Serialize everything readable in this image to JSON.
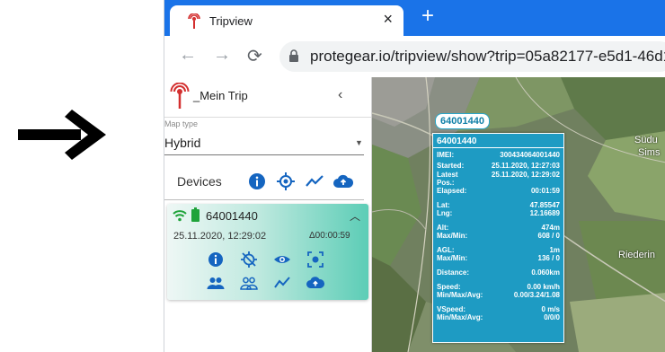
{
  "browser": {
    "tab_title": "Tripview",
    "url": "protegear.io/tripview/show?trip=05a82177-e5d1-46d1",
    "accent": "#1a73e8"
  },
  "sidebar": {
    "trip_title": "_Mein Trip",
    "map_type_label": "Map type",
    "map_type_value": "Hybrid",
    "devices_label": "Devices"
  },
  "device": {
    "name": "64001440",
    "timestamp": "25.11.2020, 12:29:02",
    "elapsed": "Δ00:00:59"
  },
  "map": {
    "marker_label": "64001440",
    "place_1": "Südu",
    "place_2": "Sims",
    "place_3": "Riederin"
  },
  "popup": {
    "title": "64001440",
    "rows": [
      {
        "k": "IMEI:",
        "v": "300434064001440"
      },
      {
        "k": "Started:",
        "v": "25.11.2020, 12:27:03"
      },
      {
        "k": "Latest",
        "v": "25.11.2020, 12:29:02"
      },
      {
        "k": "Pos.:",
        "v": ""
      },
      {
        "k": "Elapsed:",
        "v": "00:01:59"
      },
      {
        "k": "Lat:",
        "v": "47.85547"
      },
      {
        "k": "Lng:",
        "v": "12.16689"
      },
      {
        "k": "Alt:",
        "v": "474m"
      },
      {
        "k": "Max/Min:",
        "v": "608 / 0"
      },
      {
        "k": "AGL:",
        "v": "1m"
      },
      {
        "k": "Max/Min:",
        "v": "136 / 0"
      },
      {
        "k": "Distance:",
        "v": "0.060km"
      },
      {
        "k": "Speed:",
        "v": "0.00 km/h"
      },
      {
        "k": "Min/Max/Avg:",
        "v": "0.00/3.24/1.08"
      },
      {
        "k": "VSpeed:",
        "v": "0 m/s"
      },
      {
        "k": "Min/Max/Avg:",
        "v": "0/0/0"
      }
    ]
  },
  "icons": {
    "tripview_logo": "pin-antenna-icon",
    "devices_row": [
      "info-icon",
      "locate-icon",
      "chart-icon",
      "cloud-upload-icon"
    ],
    "device_row_1": [
      "info-icon",
      "no-tracking-icon",
      "eye-icon",
      "focus-icon"
    ],
    "device_row_2": [
      "group-icon",
      "group-outline-icon",
      "chart-icon",
      "cloud-upload-icon"
    ]
  },
  "colors": {
    "icon_blue": "#1565c0",
    "popup_bg": "#1e9bc3",
    "signal_green": "#1fa33a"
  }
}
